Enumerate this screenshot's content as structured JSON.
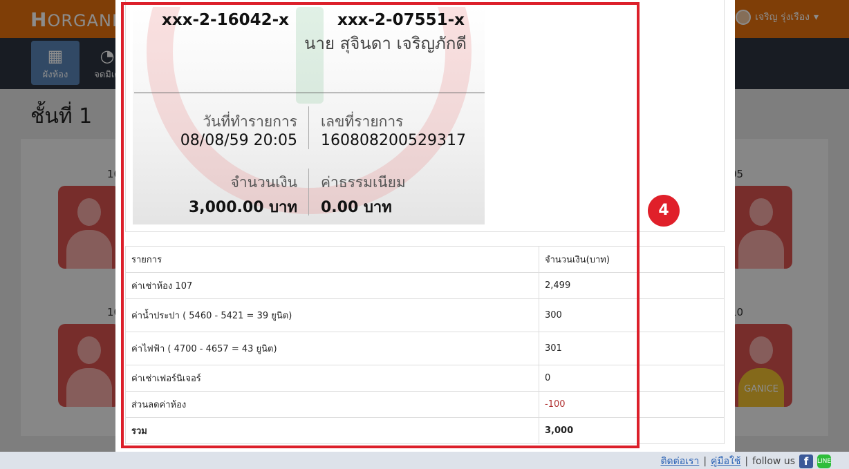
{
  "app": {
    "logo_letter": "H",
    "logo_text": "ORGANI",
    "user_name": "เจริญ รุ่งเรือง"
  },
  "nav": [
    {
      "label": "ผังห้อง",
      "icon": "building-icon"
    },
    {
      "label": "จดมิเต",
      "icon": "gauge-icon"
    }
  ],
  "floor": {
    "title": "ชั้นที่ 1"
  },
  "rooms": [
    {
      "number": "10",
      "tag": ""
    },
    {
      "number": "05",
      "tag": ""
    },
    {
      "number": "10",
      "tag": ""
    },
    {
      "number": "10",
      "tag": "GANICE"
    }
  ],
  "slip": {
    "from_account": "xxx-2-16042-x",
    "to_account": "xxx-2-07551-x",
    "to_name": "นาย สุจินดา เจริญภักดี",
    "date_label": "วันที่ทำรายการ",
    "date_value": "08/08/59 20:05",
    "ref_label": "เลขที่รายการ",
    "ref_value": "160808200529317",
    "amount_label": "จำนวนเงิน",
    "amount_value": "3,000.00 บาท",
    "fee_label": "ค่าธรรมเนียม",
    "fee_value": "0.00 บาท"
  },
  "step_badge": "4",
  "bill": {
    "headers": [
      "รายการ",
      "จำนวนเงิน(บาท)"
    ],
    "rows": [
      {
        "item": "ค่าเช่าห้อง 107",
        "amount": "2,499"
      },
      {
        "item": "ค่าน้ำประปา ( 5460 - 5421 = 39 ยูนิต)",
        "amount": "300"
      },
      {
        "item": "ค่าไฟฟ้า ( 4700 - 4657 = 43 ยูนิต)",
        "amount": "301"
      },
      {
        "item": "ค่าเช่าเฟอร์นิเจอร์",
        "amount": "0"
      },
      {
        "item": "ส่วนลดค่าห้อง",
        "amount": "-100"
      }
    ],
    "total": {
      "item": "รวม",
      "amount": "3,000"
    }
  },
  "footer": {
    "contact": "ติดต่อเรา",
    "sep": "|",
    "manual": "คู่มือใช้",
    "follow": "follow us"
  }
}
